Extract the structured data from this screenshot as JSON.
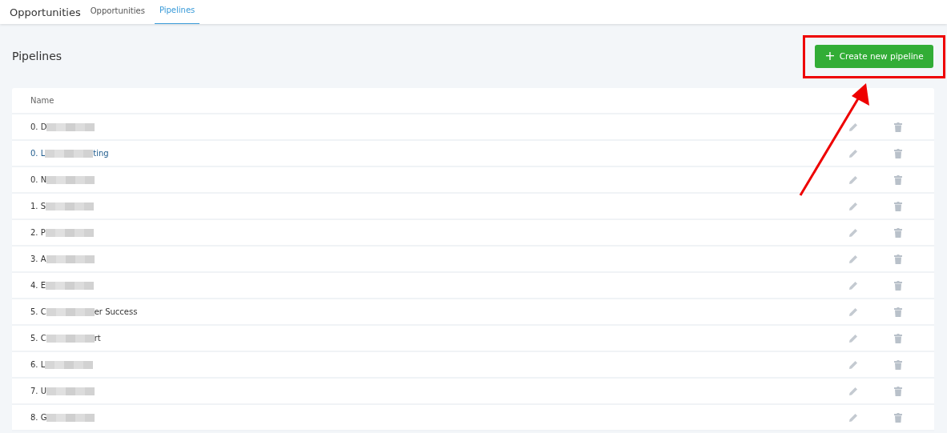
{
  "header": {
    "title": "Opportunities",
    "tabs": [
      {
        "label": "Opportunities",
        "selected": false
      },
      {
        "label": "Pipelines",
        "selected": true
      }
    ]
  },
  "page": {
    "title": "Pipelines",
    "create_button": {
      "icon": "+",
      "label": "Create new pipeline"
    }
  },
  "table": {
    "columns": [
      "Name"
    ],
    "rows": [
      {
        "prefix": "0. D",
        "suffix": "",
        "highlighted": false
      },
      {
        "prefix": "0. L",
        "suffix": "ting",
        "highlighted": true
      },
      {
        "prefix": "0. N",
        "suffix": "",
        "highlighted": false
      },
      {
        "prefix": "1. S",
        "suffix": "",
        "highlighted": false
      },
      {
        "prefix": "2. P",
        "suffix": "",
        "highlighted": false
      },
      {
        "prefix": "3. A",
        "suffix": "",
        "highlighted": false
      },
      {
        "prefix": "4. E",
        "suffix": "",
        "highlighted": false
      },
      {
        "prefix": "5. C",
        "suffix": "er Success",
        "highlighted": false
      },
      {
        "prefix": "5. C",
        "suffix": "rt",
        "highlighted": false
      },
      {
        "prefix": "6. L",
        "suffix": "",
        "highlighted": false
      },
      {
        "prefix": "7. U",
        "suffix": "",
        "highlighted": false
      },
      {
        "prefix": "8. G",
        "suffix": "",
        "highlighted": false
      }
    ]
  },
  "annotation": {
    "highlight_frame": true,
    "arrow": true
  }
}
